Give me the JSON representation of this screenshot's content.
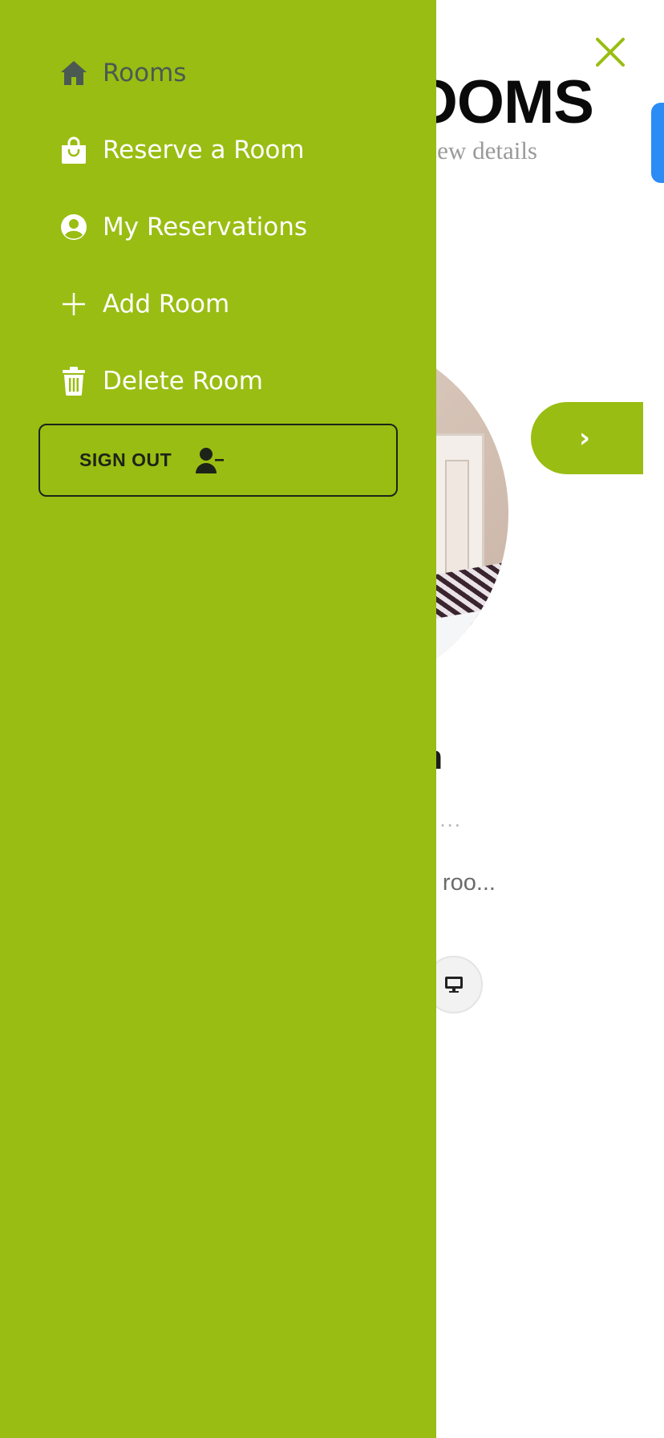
{
  "background_page": {
    "title": "OOMS",
    "subtitle": "ew details",
    "next_button": "›",
    "room_name": "n",
    "room_meta": "...",
    "room_description": "roo...",
    "amenity_icon": "monitor-icon",
    "image": "room-photo"
  },
  "close_icon": "close-icon",
  "drawer": {
    "items": [
      {
        "label": "Rooms",
        "icon": "home-icon",
        "active": true
      },
      {
        "label": "Reserve a Room",
        "icon": "shopping-bag-icon",
        "active": false
      },
      {
        "label": "My Reservations",
        "icon": "user-circle-icon",
        "active": false
      },
      {
        "label": "Add Room",
        "icon": "plus-icon",
        "active": false
      },
      {
        "label": "Delete Room",
        "icon": "trash-icon",
        "active": false
      }
    ],
    "sign_out": {
      "label": "SIGN OUT",
      "icon": "user-minus-icon"
    }
  },
  "colors": {
    "drawer_bg": "#99bd12",
    "active_item": "#4a5a52",
    "accent_blue": "#2b8cf6"
  }
}
